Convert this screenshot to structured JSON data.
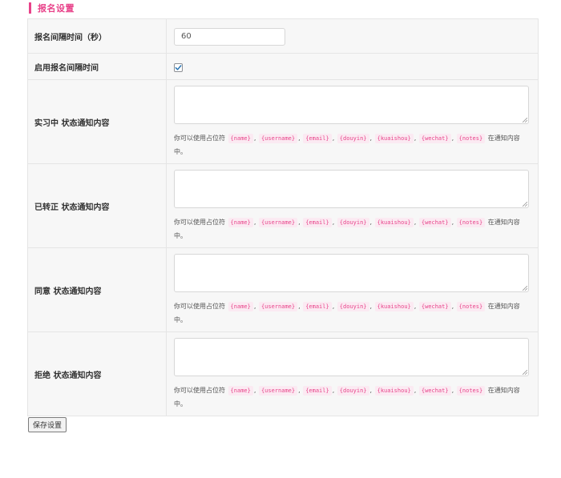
{
  "section": {
    "title": "报名设置"
  },
  "interval": {
    "label": "报名间隔时间（秒）",
    "value": "60"
  },
  "enable_interval": {
    "label": "启用报名间隔时间",
    "checked": true
  },
  "help": {
    "prefix": "你可以使用占位符",
    "suffix": "在通知内容中。",
    "separator": ",",
    "placeholders": [
      "{name}",
      "{username}",
      "{email}",
      "{douyin}",
      "{kuaishou}",
      "{wechat}",
      "{notes}"
    ]
  },
  "status_rows": [
    {
      "label": "实习中 状态通知内容",
      "value": ""
    },
    {
      "label": "已转正 状态通知内容",
      "value": ""
    },
    {
      "label": "同意 状态通知内容",
      "value": ""
    },
    {
      "label": "拒绝 状态通知内容",
      "value": ""
    }
  ],
  "save_button": {
    "label": "保存设置"
  },
  "colors": {
    "accent": "#e8438a",
    "tag_bg": "#fbeaf2",
    "table_bg": "#f7f7f7",
    "check": "#2271b1"
  },
  "icons": {
    "checkbox": "checkmark-icon",
    "resize": "resize-handle-icon"
  }
}
